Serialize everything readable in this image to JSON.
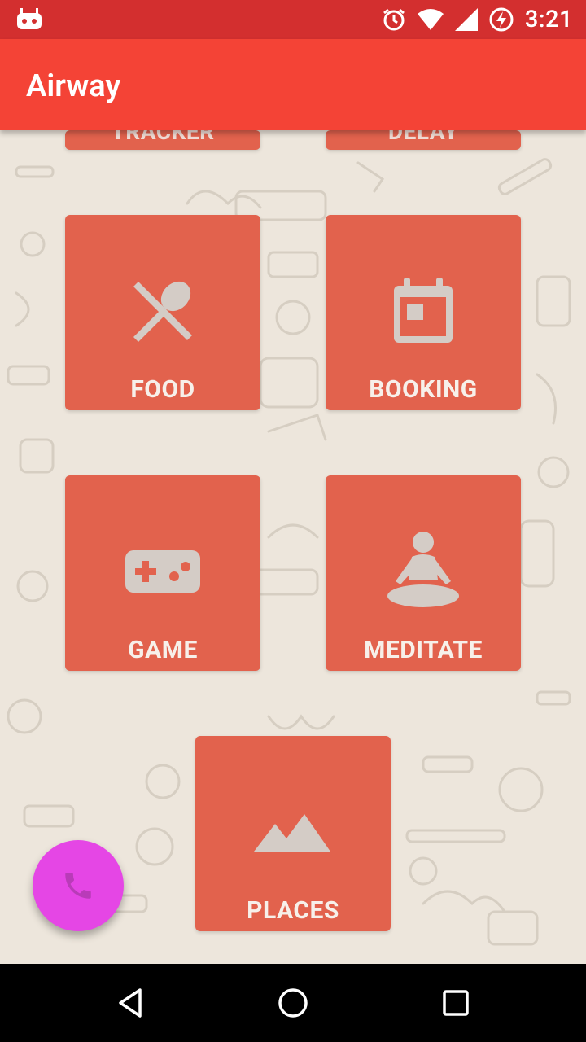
{
  "status": {
    "time": "3:21"
  },
  "appbar": {
    "title": "Airway"
  },
  "tiles_partial": [
    {
      "label": "TRACKER"
    },
    {
      "label": "DELAY"
    }
  ],
  "tiles": [
    {
      "label": "FOOD",
      "icon": "food-icon"
    },
    {
      "label": "BOOKING",
      "icon": "calendar-icon"
    },
    {
      "label": "GAME",
      "icon": "gamepad-icon"
    },
    {
      "label": "MEDITATE",
      "icon": "meditate-icon"
    },
    {
      "label": "PLACES",
      "icon": "landscape-icon"
    }
  ],
  "fab": {
    "icon": "phone-icon"
  },
  "colors": {
    "status_bar": "#d32f2f",
    "app_bar": "#f44336",
    "tile": "#e2624d",
    "fab": "#e546e5",
    "background": "#ede6dc"
  }
}
